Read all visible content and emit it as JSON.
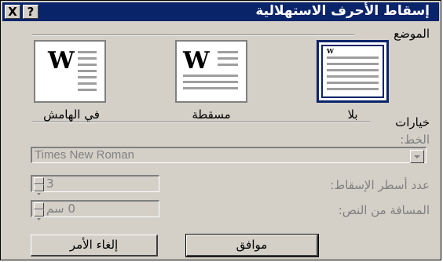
{
  "window": {
    "title": "إسقاط الأحرف الاستهلالية",
    "help_label": "?",
    "close_label": "X"
  },
  "position": {
    "group_label": "الموضع",
    "options": [
      {
        "label": "بلا",
        "selected": true
      },
      {
        "label": "مسقطة",
        "selected": false
      },
      {
        "label": "في الهامش",
        "selected": false
      }
    ],
    "icon_letter": "W"
  },
  "options_group": {
    "label": "خيارات",
    "font_label": "الخط:",
    "font_value": "Times New Roman",
    "lines_label": "عدد أسطر الإسقاط:",
    "lines_value": "3",
    "distance_label": "المسافة من النص:",
    "distance_value": "0 سم"
  },
  "buttons": {
    "ok": "موافق",
    "cancel": "إلغاء الأمر"
  },
  "colors": {
    "titlebar": "#0a246a",
    "face": "#d4d0c8",
    "disabled_text": "#808080"
  }
}
